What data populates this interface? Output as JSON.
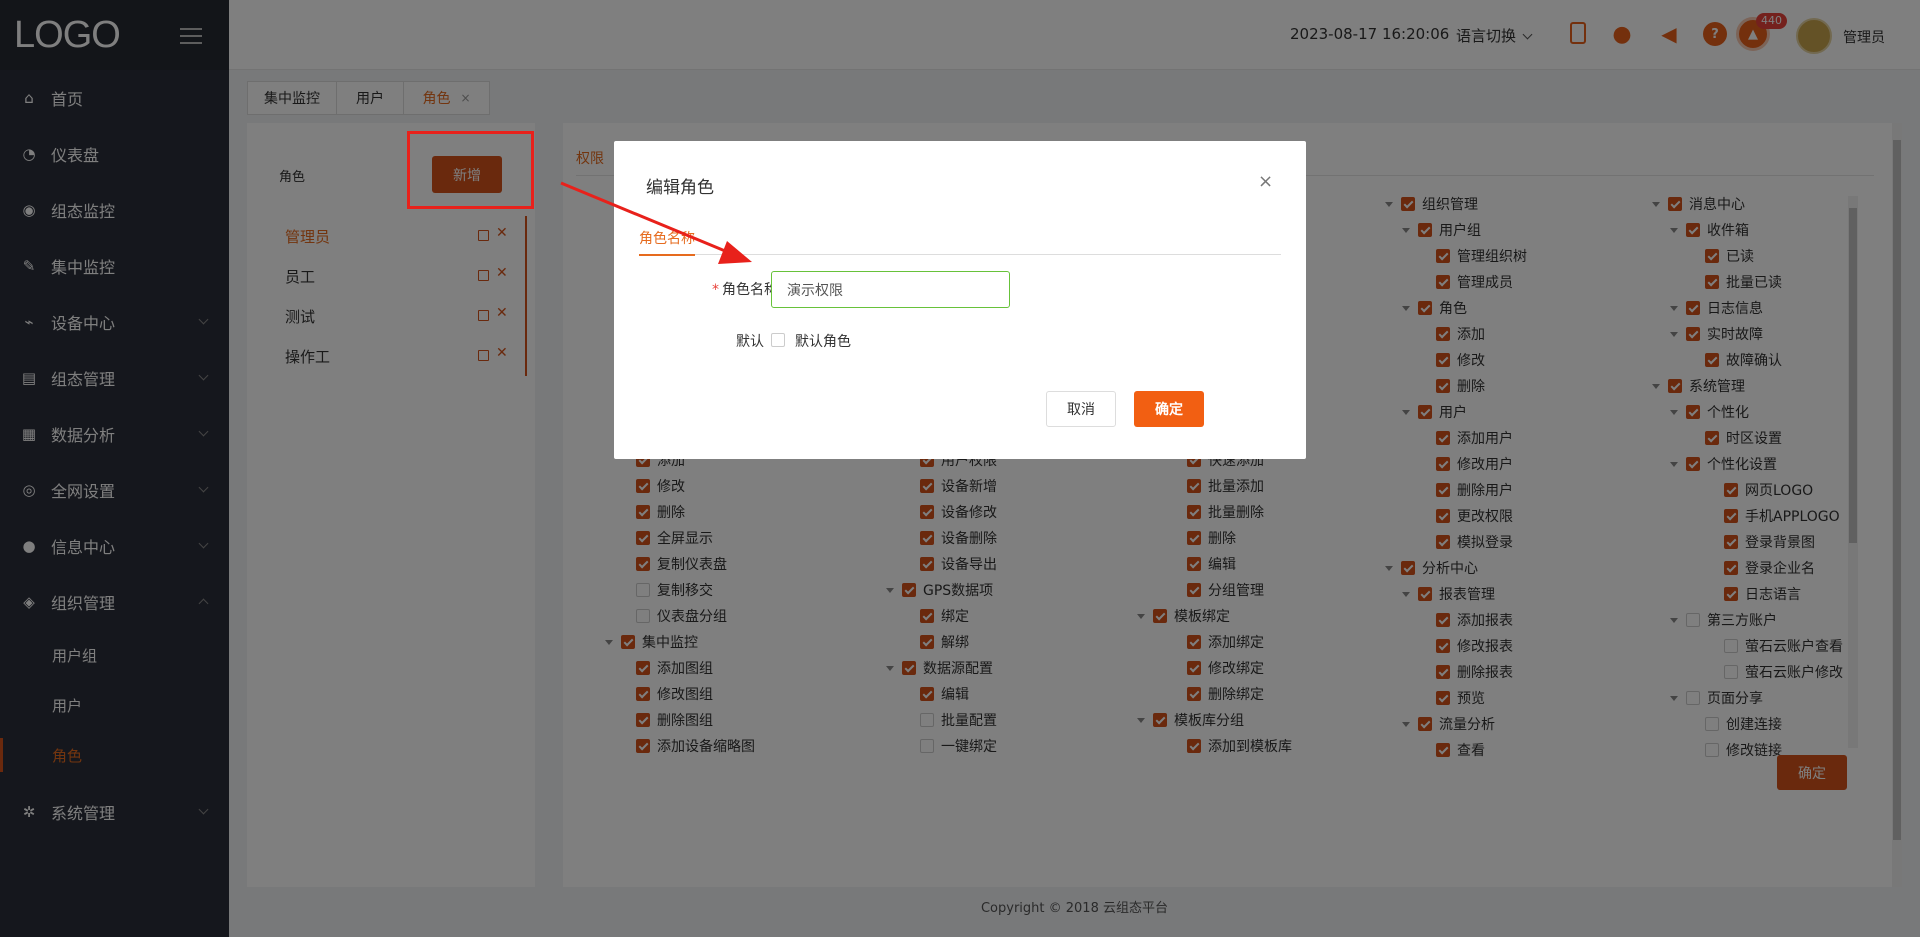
{
  "app": {
    "logo": "LOGO"
  },
  "sidebar": {
    "items": [
      {
        "label": "首页",
        "icon": "home-icon",
        "glyph": "⌂",
        "expandable": false
      },
      {
        "label": "仪表盘",
        "icon": "dashboard-icon",
        "glyph": "◔",
        "expandable": false
      },
      {
        "label": "组态监控",
        "icon": "monitor-icon",
        "glyph": "◉",
        "expandable": false
      },
      {
        "label": "集中监控",
        "icon": "broom-icon",
        "glyph": "✎",
        "expandable": false
      },
      {
        "label": "设备中心",
        "icon": "router-icon",
        "glyph": "⌁",
        "expandable": true
      },
      {
        "label": "组态管理",
        "icon": "document-icon",
        "glyph": "▤",
        "expandable": true
      },
      {
        "label": "数据分析",
        "icon": "chart-icon",
        "glyph": "▦",
        "expandable": true
      },
      {
        "label": "全网设置",
        "icon": "settings-circle-icon",
        "glyph": "◎",
        "expandable": true
      },
      {
        "label": "信息中心",
        "icon": "chat-icon",
        "glyph": "●",
        "expandable": true
      },
      {
        "label": "组织管理",
        "icon": "layers-icon",
        "glyph": "◈",
        "expandable": true,
        "open": true
      }
    ],
    "sub_items": [
      {
        "label": "用户组"
      },
      {
        "label": "用户"
      },
      {
        "label": "角色",
        "active": true
      }
    ],
    "last_item": {
      "label": "系统管理",
      "icon": "gear-icon",
      "glyph": "✲"
    }
  },
  "topbar": {
    "datetime": "2023-08-17 16:20:06",
    "language": "语言切换",
    "badge_count": "440",
    "username": "管理员",
    "icons": [
      "phone-icon",
      "wechat-icon",
      "speaker-icon",
      "help-icon",
      "alarm-icon"
    ]
  },
  "tabs": [
    {
      "label": "集中监控"
    },
    {
      "label": "用户"
    },
    {
      "label": "角色",
      "active": true,
      "closable": "×"
    }
  ],
  "roles_panel": {
    "title": "角色",
    "add_button": "新增",
    "roles": [
      {
        "name": "管理员",
        "active": true
      },
      {
        "name": "员工"
      },
      {
        "name": "测试"
      },
      {
        "name": "操作工"
      }
    ]
  },
  "permissions_panel": {
    "tab": "权限",
    "confirm": "确定"
  },
  "tree": {
    "col1": [
      {
        "label": "添加",
        "checked": true
      },
      {
        "label": "修改",
        "checked": true
      },
      {
        "label": "删除",
        "checked": true
      },
      {
        "label": "全屏显示",
        "checked": true
      },
      {
        "label": "复制仪表盘",
        "checked": true
      },
      {
        "label": "复制移交",
        "checked": false
      },
      {
        "label": "仪表盘分组",
        "checked": false
      },
      {
        "label": "集中监控",
        "checked": true,
        "parent": true
      },
      {
        "label": "添加图组",
        "checked": true
      },
      {
        "label": "修改图组",
        "checked": true
      },
      {
        "label": "删除图组",
        "checked": true
      },
      {
        "label": "添加设备缩略图",
        "checked": true
      }
    ],
    "col2": [
      {
        "label": "用户权限",
        "checked": true
      },
      {
        "label": "设备新增",
        "checked": true
      },
      {
        "label": "设备修改",
        "checked": true
      },
      {
        "label": "设备删除",
        "checked": true
      },
      {
        "label": "设备导出",
        "checked": true
      },
      {
        "label": "GPS数据项",
        "checked": true,
        "parent": true
      },
      {
        "label": "绑定",
        "checked": true
      },
      {
        "label": "解绑",
        "checked": true
      },
      {
        "label": "数据源配置",
        "checked": true,
        "parent": true
      },
      {
        "label": "编辑",
        "checked": true
      },
      {
        "label": "批量配置",
        "checked": false
      },
      {
        "label": "一键绑定",
        "checked": false
      }
    ],
    "col3": [
      {
        "label": "快速添加",
        "checked": true
      },
      {
        "label": "批量添加",
        "checked": true
      },
      {
        "label": "批量删除",
        "checked": true
      },
      {
        "label": "删除",
        "checked": true
      },
      {
        "label": "编辑",
        "checked": true
      },
      {
        "label": "分组管理",
        "checked": true
      },
      {
        "label": "模板绑定",
        "checked": true,
        "parent": true
      },
      {
        "label": "添加绑定",
        "checked": true
      },
      {
        "label": "修改绑定",
        "checked": true
      },
      {
        "label": "删除绑定",
        "checked": true
      },
      {
        "label": "模板库分组",
        "checked": true,
        "parent": true
      },
      {
        "label": "添加到模板库",
        "checked": true
      }
    ],
    "col4": [
      {
        "label": "组织管理",
        "checked": true,
        "level": 0
      },
      {
        "label": "用户组",
        "checked": true,
        "level": 1
      },
      {
        "label": "管理组织树",
        "checked": true,
        "level": 2
      },
      {
        "label": "管理成员",
        "checked": true,
        "level": 2
      },
      {
        "label": "角色",
        "checked": true,
        "level": 1
      },
      {
        "label": "添加",
        "checked": true,
        "level": 2
      },
      {
        "label": "修改",
        "checked": true,
        "level": 2
      },
      {
        "label": "删除",
        "checked": true,
        "level": 2
      },
      {
        "label": "用户",
        "checked": true,
        "level": 1
      },
      {
        "label": "添加用户",
        "checked": true,
        "level": 2
      },
      {
        "label": "修改用户",
        "checked": true,
        "level": 2
      },
      {
        "label": "删除用户",
        "checked": true,
        "level": 2
      },
      {
        "label": "更改权限",
        "checked": true,
        "level": 2
      },
      {
        "label": "模拟登录",
        "checked": true,
        "level": 2
      },
      {
        "label": "分析中心",
        "checked": true,
        "level": 0
      },
      {
        "label": "报表管理",
        "checked": true,
        "level": 1
      },
      {
        "label": "添加报表",
        "checked": true,
        "level": 2
      },
      {
        "label": "修改报表",
        "checked": true,
        "level": 2
      },
      {
        "label": "删除报表",
        "checked": true,
        "level": 2
      },
      {
        "label": "预览",
        "checked": true,
        "level": 2
      },
      {
        "label": "流量分析",
        "checked": true,
        "level": 1
      },
      {
        "label": "查看",
        "checked": true,
        "level": 2
      }
    ],
    "col5": [
      {
        "label": "消息中心",
        "checked": true,
        "level": 0
      },
      {
        "label": "收件箱",
        "checked": true,
        "level": 1
      },
      {
        "label": "已读",
        "checked": true,
        "level": 2
      },
      {
        "label": "批量已读",
        "checked": true,
        "level": 2
      },
      {
        "label": "日志信息",
        "checked": true,
        "level": 1
      },
      {
        "label": "实时故障",
        "checked": true,
        "level": 1
      },
      {
        "label": "故障确认",
        "checked": true,
        "level": 2
      },
      {
        "label": "系统管理",
        "checked": true,
        "level": 0
      },
      {
        "label": "个性化",
        "checked": true,
        "level": 1
      },
      {
        "label": "时区设置",
        "checked": true,
        "level": 2
      },
      {
        "label": "个性化设置",
        "checked": true,
        "level": 2
      },
      {
        "label": "网页LOGO",
        "checked": true,
        "level": 3
      },
      {
        "label": "手机APPLOGO",
        "checked": true,
        "level": 3
      },
      {
        "label": "登录背景图",
        "checked": true,
        "level": 3
      },
      {
        "label": "登录企业名",
        "checked": true,
        "level": 3
      },
      {
        "label": "日志语言",
        "checked": true,
        "level": 3
      },
      {
        "label": "第三方账户",
        "checked": false,
        "level": 2
      },
      {
        "label": "萤石云账户查看",
        "checked": false,
        "level": 3
      },
      {
        "label": "萤石云账户修改",
        "checked": false,
        "level": 3
      },
      {
        "label": "页面分享",
        "checked": false,
        "level": 1
      },
      {
        "label": "创建连接",
        "checked": false,
        "level": 2
      },
      {
        "label": "修改链接",
        "checked": false,
        "level": 2
      }
    ]
  },
  "footer": "Copyright © 2018 云组态平台",
  "modal": {
    "title": "编辑角色",
    "tab": "角色名称",
    "name_label": "角色名称",
    "name_value": "演示权限",
    "default_label": "默认",
    "default_checkbox": "默认角色",
    "cancel": "取消",
    "ok": "确定",
    "close": "×"
  },
  "colors": {
    "accent": "#d4521a",
    "sidebar_bg": "#2b2f3a",
    "annotation_red": "#e8211b",
    "input_border_valid": "#67c23a"
  }
}
